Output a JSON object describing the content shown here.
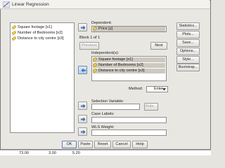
{
  "window": {
    "title": "Linear Regression"
  },
  "variables": [
    {
      "label": "Square footage [x1]",
      "icon": "ruler-scale-icon"
    },
    {
      "label": "Number of Bedrooms [x2]",
      "icon": "ruler-scale-icon"
    },
    {
      "label": "Distance to city centre [x3]",
      "icon": "ruler-scale-icon"
    }
  ],
  "dependent": {
    "label": "Dependent:",
    "value": "Price [y]"
  },
  "block": {
    "label": "Block 1 of 1",
    "previous": "Previous",
    "next": "Next"
  },
  "independents": {
    "label": "Independent(s):",
    "items": [
      "Square footage [x1]",
      "Number of Bedrooms [x2]",
      "Distance to city centre [x3]"
    ]
  },
  "method": {
    "label": "Method:",
    "value": "Enter"
  },
  "selection": {
    "label": "Selection Variable:",
    "rule_button": "Rule..."
  },
  "case_labels": {
    "label": "Case Labels:"
  },
  "wls": {
    "label": "WLS Weight:"
  },
  "side_buttons": [
    "Statistics...",
    "Plots...",
    "Save...",
    "Options...",
    "Style...",
    "Bootstrap..."
  ],
  "footer_buttons": [
    "OK",
    "Paste",
    "Reset",
    "Cancel",
    "Help"
  ],
  "data_row": [
    "73.00",
    "3.00",
    "5.20"
  ],
  "colors": {
    "accent": "#4a7cc0",
    "dialog_bg": "#e9e7e2",
    "selected_bg": "#cdc9c0"
  }
}
